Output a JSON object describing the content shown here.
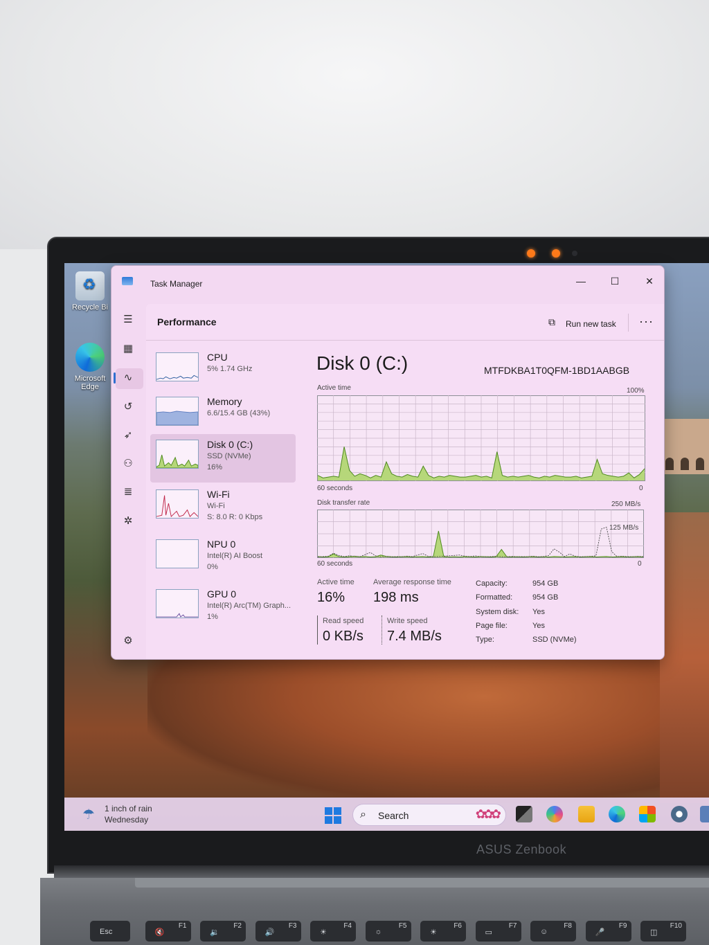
{
  "desktop": {
    "icons": [
      {
        "label": "Recycle Bi"
      },
      {
        "label": "Microsoft Edge"
      }
    ]
  },
  "taskbar": {
    "weather_line1": "1 inch of rain",
    "weather_line2": "Wednesday",
    "search_label": "Search"
  },
  "device_brand": "ASUS Zenbook",
  "keyboard": [
    {
      "label": "Esc"
    },
    {
      "label": "F1"
    },
    {
      "label": "F2"
    },
    {
      "label": "F3"
    },
    {
      "label": "F4"
    },
    {
      "label": "F5"
    },
    {
      "label": "F6"
    },
    {
      "label": "F7"
    },
    {
      "label": "F8"
    },
    {
      "label": "F9"
    },
    {
      "label": "F10"
    }
  ],
  "window": {
    "title": "Task Manager",
    "section_title": "Performance",
    "run_new_task": "Run new task"
  },
  "devices": [
    {
      "name": "CPU",
      "sub1": "5%  1.74 GHz",
      "sub2": ""
    },
    {
      "name": "Memory",
      "sub1": "6.6/15.4 GB (43%)",
      "sub2": ""
    },
    {
      "name": "Disk 0 (C:)",
      "sub1": "SSD (NVMe)",
      "sub2": "16%"
    },
    {
      "name": "Wi-Fi",
      "sub1": "Wi-Fi",
      "sub2": "S: 8.0  R: 0 Kbps"
    },
    {
      "name": "NPU 0",
      "sub1": "Intel(R) AI Boost",
      "sub2": "0%"
    },
    {
      "name": "GPU 0",
      "sub1": "Intel(R) Arc(TM) Graph...",
      "sub2": "1%"
    }
  ],
  "disk": {
    "title": "Disk 0 (C:)",
    "model": "MTFDKBA1T0QFM-1BD1AABGB",
    "active_time_label": "Active time",
    "active_time_max": "100%",
    "active_time_min": "0",
    "active_time_span": "60 seconds",
    "transfer_label": "Disk transfer rate",
    "transfer_max": "250 MB/s",
    "transfer_mid": "125 MB/s",
    "transfer_min": "0",
    "transfer_span": "60 seconds",
    "stats": {
      "active_time_label": "Active time",
      "active_time": "16%",
      "avg_response_label": "Average response time",
      "avg_response": "198 ms",
      "read_label": "Read speed",
      "read": "0 KB/s",
      "write_label": "Write speed",
      "write": "7.4 MB/s"
    },
    "properties": [
      {
        "key": "Capacity:",
        "value": "954 GB"
      },
      {
        "key": "Formatted:",
        "value": "954 GB"
      },
      {
        "key": "System disk:",
        "value": "Yes"
      },
      {
        "key": "Page file:",
        "value": "Yes"
      },
      {
        "key": "Type:",
        "value": "SSD (NVMe)"
      }
    ]
  },
  "colors": {
    "disk_fill": "#b6d77a",
    "disk_line": "#4e8a1e",
    "wifi_line": "#c0284a",
    "memory_fill": "#9fb3e0",
    "window_bg": "#f3d9f2"
  },
  "chart_data": [
    {
      "type": "area",
      "title": "Active time",
      "x_range_label": "60 seconds",
      "ylim": [
        0,
        100
      ],
      "ylabel": "",
      "values": [
        6,
        3,
        4,
        5,
        4,
        40,
        12,
        5,
        8,
        6,
        3,
        6,
        4,
        22,
        8,
        5,
        4,
        7,
        5,
        4,
        17,
        6,
        3,
        5,
        4,
        6,
        5,
        4,
        4,
        5,
        6,
        4,
        5,
        3,
        34,
        6,
        4,
        5,
        4,
        5,
        6,
        4,
        3,
        5,
        4,
        6,
        5,
        4,
        4,
        5,
        3,
        4,
        5,
        25,
        8,
        6,
        5,
        4,
        5,
        9,
        3,
        7,
        14
      ]
    },
    {
      "type": "line",
      "title": "Disk transfer rate",
      "x_range_label": "60 seconds",
      "ylim": [
        0,
        250
      ],
      "series": [
        {
          "values": [
            4,
            2,
            3,
            18,
            4,
            2,
            3,
            6,
            3,
            4,
            2,
            3,
            12,
            5,
            3,
            2,
            3,
            4,
            2,
            3,
            4,
            2,
            3,
            140,
            4,
            2,
            3,
            2,
            4,
            3,
            2,
            4,
            3,
            2,
            4,
            42,
            3,
            2,
            3,
            2,
            3,
            4,
            2,
            3,
            2,
            4,
            3,
            2,
            3,
            4,
            2,
            3,
            4,
            2,
            3,
            4,
            2,
            3,
            4,
            2,
            3,
            4,
            2
          ]
        },
        {
          "values": [
            2,
            4,
            6,
            22,
            10,
            4,
            8,
            5,
            3,
            14,
            26,
            8,
            3,
            5,
            2,
            4,
            3,
            6,
            4,
            12,
            20,
            6,
            3,
            4,
            6,
            8,
            10,
            12,
            6,
            4,
            8,
            3,
            3,
            4,
            6,
            3,
            3,
            5,
            3,
            4,
            3,
            6,
            3,
            4,
            10,
            45,
            28,
            4,
            18,
            6,
            3,
            4,
            5,
            8,
            150,
            160,
            30,
            4,
            6,
            4,
            3,
            5,
            4
          ]
        }
      ]
    }
  ]
}
